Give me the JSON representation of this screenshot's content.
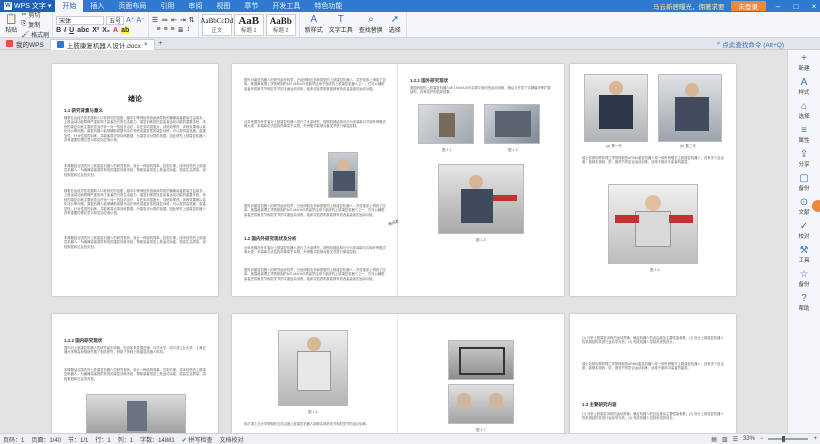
{
  "app": {
    "name": "WPS 文字",
    "menu_tabs": [
      "开始",
      "插入",
      "页面布局",
      "引用",
      "审阅",
      "视图",
      "章节",
      "开发工具",
      "特色功能"
    ],
    "active_tab": "开始",
    "promo": "马云新居曝光，佣著求要",
    "login": "未登录"
  },
  "ribbon": {
    "paste": "粘贴",
    "cut": "剪切",
    "copy": "复制",
    "format_painter": "格式刷",
    "font_name": "宋体",
    "font_size": "五号",
    "styles": [
      {
        "sample": "AaBbCcDd",
        "label": "正文"
      },
      {
        "sample": "AaB",
        "label": "标题 1"
      },
      {
        "sample": "AaBb",
        "label": "标题 2"
      }
    ],
    "new_style": "新样式",
    "text_tools": "文字工具",
    "find_replace": "查找替换",
    "select": "选择"
  },
  "tabs": {
    "home": "我的WPS",
    "document": "上肢康复机器人设计.docx",
    "search_hint": "点此查找命令 (Alt+Q)"
  },
  "pages": {
    "p1": {
      "title": "绪论",
      "sec1": "1.1 研究背景与意义",
      "body1": "随着社会经济的发展和人口老龄化的加剧，脑卒中等神经系统疾病导致的偏瘫患者数量日益增多，上肢运动功能障碍严重影响了患者的日常生活能力。康复训练是恢复患者运动功能的重要手段，传统的康复训练主要依靠治疗师一对一的徒手治疗，存在劳动强度大、训练效率低、训练效果难以量化评价等问题。康复机器人能够辅助或替代治疗师完成重复性的康复训练，可以提供高强度、高重复性、针对性强的训练，并能客观记录训练数据，为康复评价提供依据。因此研究上肢康复机器人具有重要的理论意义和实际应用价值。",
      "body2": "本课题结合国内外上肢康复机器人的研究现状，设计一种结构简单、控制方便、成本较低的上肢康复机器人，为偏瘫患者提供有效的康复训练手段，帮助患者恢复上肢运动功能，提高生活质量，减轻家庭和社会的负担。"
    },
    "p2": {
      "body1": "国外对康复机器人的研究起步较早，已经研制出多种类型的上肢康复机器人，并在临床上得到了应用。美国麻省理工学院研制的MIT-MANUS是最早应用于临床的上肢康复机器人之一，它可以辅助患者完成肩关节和肘关节的平面运动训练，临床试验表明其能够有效改善患者的运动功能。",
      "sec": "1.2 国内外研究现状及分析",
      "body2": "近年来国内外学者对上肢康复机器人进行了大量研究，按照机械结构可分为末端牵引式和外骨骼式两大类，末端牵引式结构简单易于实现，外骨骼式能够对各关节进行单独控制。",
      "comment": "有问题"
    },
    "p3": {
      "sec": "1.2.1 国外研究现状",
      "body1": "美国研制的上肢康复机器人MIT-MANUS可实现平面内的运动训练，随后又开发了手腕模块等扩展结构，具有较好的临床效果。",
      "cap1": "图 1-1",
      "cap2": "图 1-2",
      "cap3": "图 1-3"
    },
    "p4": {
      "cap1": "(a) 第一代",
      "cap2": "(b) 第二代",
      "body1": "瑞士苏黎世联邦理工学院研制的ARMin康复机器人是一种外骨骼式上肢康复机器人，具有多个自由度，能够实现肩、肘、腕关节的复合运动训练，适用于脑卒中患者的康复。",
      "cap3": "图 1-4",
      "cap4": "图 1-5"
    },
    "p5": {
      "sec": "1.2.2 国内研究现状",
      "body": "国内对上肢康复机器人的研究起步较晚，但近年来发展迅速，清华大学、哈尔滨工业大学、上海交通大学等高校相继开展了相关研究，研制了多种上肢康复机器人样机。"
    },
    "p6": {
      "cap": "图 1-6",
      "body": "哈尔滨工业大学研制的五自由度上肢康复机器人能够实现肩关节和肘关节的运动训练。"
    },
    "p7": {
      "cap": "图 1-7"
    },
    "p8": {
      "sec": "1.3 主要研究内容",
      "body": "(1) 分析上肢康复训练的运动规律，确定机器人的自由度及主要性能参数。(2) 设计上肢康复机器人的机械结构并进行运动学分析。(3) 完成机器人控制系统的设计。"
    }
  },
  "sidebar": [
    {
      "icon": "+",
      "label": "新建"
    },
    {
      "icon": "A",
      "label": "样式"
    },
    {
      "icon": "⌂",
      "label": "选择"
    },
    {
      "icon": "≡",
      "label": "属性"
    },
    {
      "icon": "⇪",
      "label": "分享"
    },
    {
      "icon": "▢",
      "label": "备份"
    },
    {
      "icon": "⊙",
      "label": "文献"
    },
    {
      "icon": "✓",
      "label": "校对"
    },
    {
      "icon": "⚒",
      "label": "工具"
    },
    {
      "icon": "☆",
      "label": "备份"
    },
    {
      "icon": "?",
      "label": "帮助"
    }
  ],
  "status": {
    "page": "页码：1",
    "pages": "页面：1/40",
    "section": "节：1/1",
    "row": "行：1",
    "col": "列：1",
    "words": "字数：14881",
    "spell": "拼写检查",
    "doc_check": "文档校对",
    "zoom": "33%"
  }
}
